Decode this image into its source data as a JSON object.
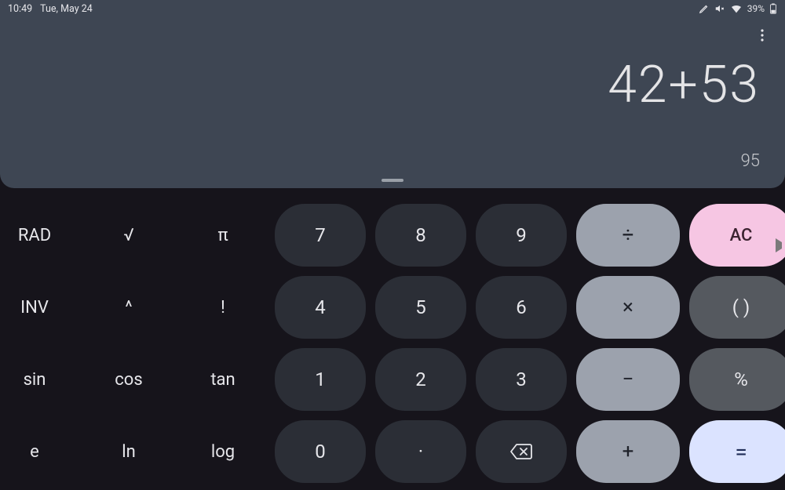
{
  "status": {
    "time": "10:49",
    "date": "Tue, May 24",
    "battery_pct": "39%"
  },
  "display": {
    "expression": "42+53",
    "result": "95"
  },
  "keys": {
    "rad": "RAD",
    "sqrt": "√",
    "pi": "π",
    "inv": "INV",
    "pow": "^",
    "fact": "!",
    "sin": "sin",
    "cos": "cos",
    "tan": "tan",
    "e": "e",
    "ln": "ln",
    "log": "log",
    "n7": "7",
    "n8": "8",
    "n9": "9",
    "n4": "4",
    "n5": "5",
    "n6": "6",
    "n1": "1",
    "n2": "2",
    "n3": "3",
    "n0": "0",
    "dot": "·",
    "div": "÷",
    "mul": "×",
    "sub": "−",
    "add": "+",
    "ac": "AC",
    "paren": "( )",
    "pct": "%",
    "eq": "="
  }
}
